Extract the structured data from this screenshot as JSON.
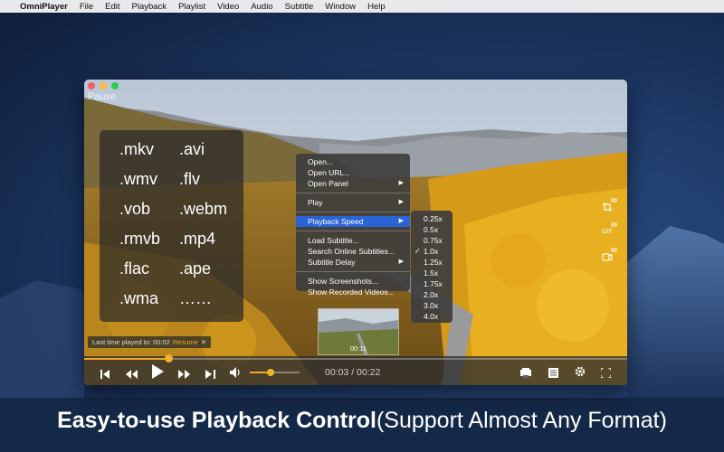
{
  "menubar": {
    "app_name": "OmniPlayer",
    "items": [
      "File",
      "Edit",
      "Playback",
      "Playlist",
      "Video",
      "Audio",
      "Subtitle",
      "Window",
      "Help"
    ]
  },
  "window": {
    "paused_label": "Pause"
  },
  "formats": [
    ".mkv",
    ".avi",
    ".wmv",
    ".flv",
    ".vob",
    ".webm",
    ".rmvb",
    ".mp4",
    ".flac",
    ".ape",
    ".wma",
    "……"
  ],
  "context_menu": {
    "items": [
      {
        "label": "Open..."
      },
      {
        "label": "Open URL..."
      },
      {
        "label": "Open Panel",
        "submenu": true
      },
      {
        "label": "Play",
        "submenu": true
      },
      {
        "label": "Playback Speed",
        "submenu": true,
        "highlighted": true
      },
      {
        "label": "Load Subtitle..."
      },
      {
        "label": "Search Online Subtitles..."
      },
      {
        "label": "Subtitle Delay",
        "submenu": true
      },
      {
        "label": "Show Screenshots..."
      },
      {
        "label": "Show Recorded Videos..."
      }
    ],
    "speed_options": [
      "0.25x",
      "0.5x",
      "0.75x",
      "1.0x",
      "1.25x",
      "1.5x",
      "1.75x",
      "2.0x",
      "3.0x",
      "4.0x"
    ],
    "selected_speed": "1.0x"
  },
  "side_buttons": {
    "gif_label": "GIF",
    "icons": [
      "crop-screenshot-icon",
      "gif-icon",
      "record-video-icon"
    ]
  },
  "resume": {
    "text": "Last time played to: 00:02",
    "resume_label": "Resume",
    "close_symbol": "✕"
  },
  "thumbnail": {
    "time": "00:11"
  },
  "playback": {
    "current_time": "00:03",
    "total_time": "00:22",
    "time_display": "00:03 / 00:22",
    "progress_fraction": 0.155,
    "volume_fraction": 0.42
  },
  "caption": {
    "bold_part": "Easy-to-use Playback Control",
    "normal_part": "(Support Almost Any Format)"
  },
  "colors": {
    "accent": "#f0a824",
    "menu_highlight": "#2a63d6",
    "desktop": "#1e3a68"
  }
}
